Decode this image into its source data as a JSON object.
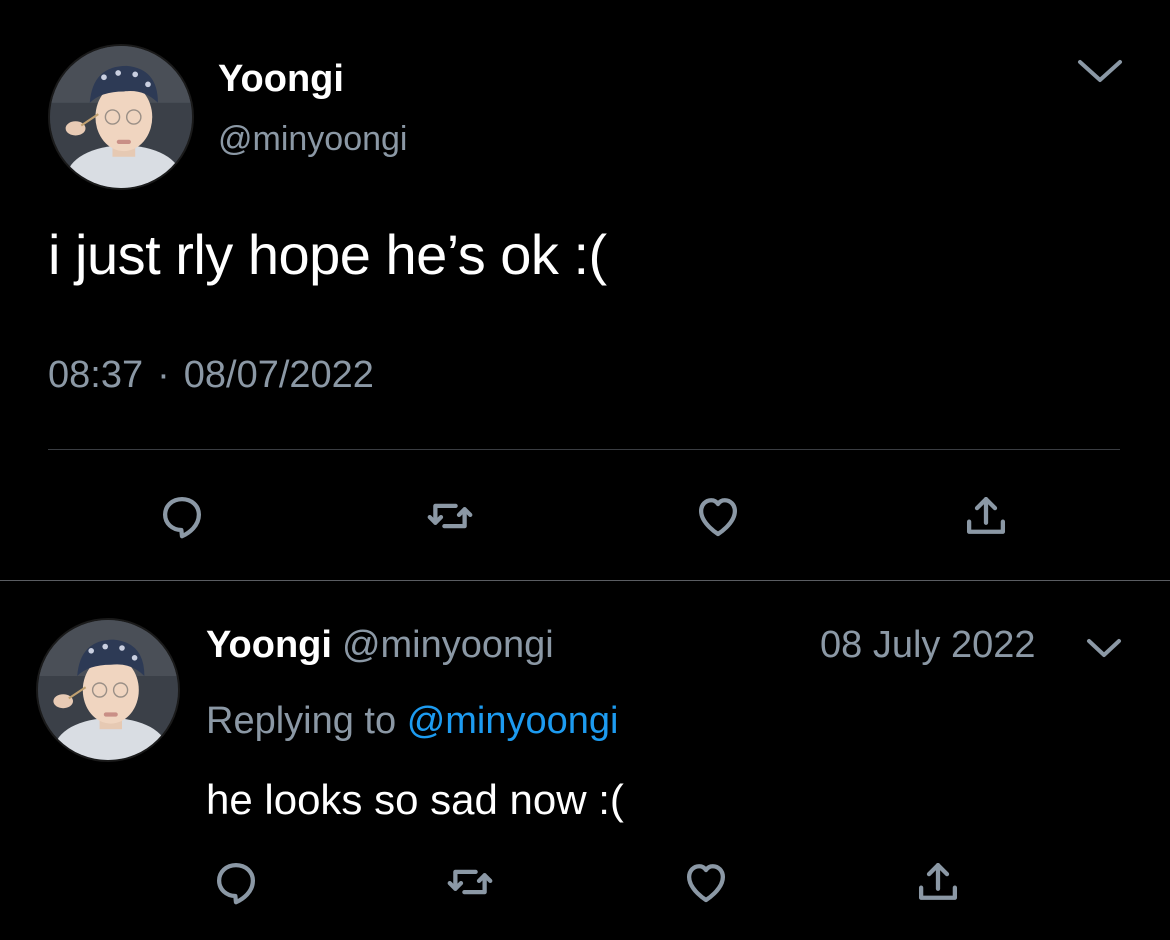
{
  "main_tweet": {
    "display_name": "Yoongi",
    "handle": "@minyoongi",
    "text": "i just rly hope he’s ok :(",
    "time": "08:37",
    "separator": "·",
    "date": "08/07/2022",
    "icons": {
      "avatar": "profile-photo",
      "menu": "chevron-down-icon",
      "reply": "reply-icon",
      "retweet": "retweet-icon",
      "like": "heart-icon",
      "share": "share-icon"
    }
  },
  "reply_tweet": {
    "display_name": "Yoongi",
    "handle": "@minyoongi",
    "date": "08 July 2022",
    "replying_prefix": "Replying to",
    "replying_to": "@minyoongi",
    "text": "he looks so sad now :("
  },
  "colors": {
    "background": "#000000",
    "primary_text": "#ffffff",
    "secondary_text": "#8b98a5",
    "accent_link": "#1d9bf0",
    "divider": "#3a3d42"
  }
}
